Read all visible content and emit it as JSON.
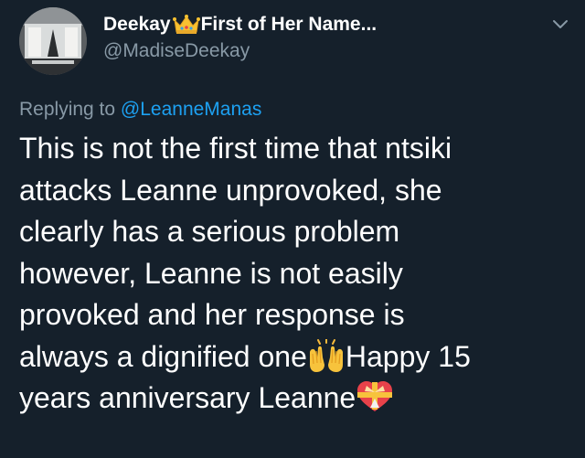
{
  "tweet": {
    "display_name": "Deekay",
    "display_name_suffix": "First of Her Name...",
    "crown_icon": "crown-emoji",
    "handle": "@MadiseDeekay",
    "replying_prefix": "Replying to ",
    "replying_mention": "@LeanneManas",
    "body_lines": [
      "This is not the first time that ntsiki",
      "attacks Leanne unprovoked, she",
      "clearly has a serious problem",
      "however, Leanne is not easily",
      "provoked and her response is",
      "always a dignified one",
      "Happy 15",
      "years anniversary Leanne"
    ],
    "emojis": [
      "raising-hands-emoji",
      "gift-heart-emoji"
    ]
  },
  "colors": {
    "background": "#15202b",
    "text": "#ffffff",
    "secondary": "#8899a6",
    "link": "#1da1f2"
  }
}
